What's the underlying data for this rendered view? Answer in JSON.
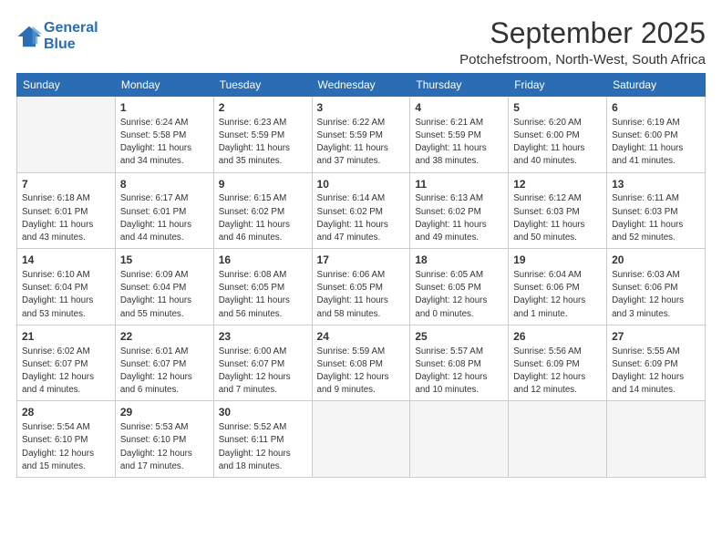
{
  "logo": {
    "line1": "General",
    "line2": "Blue"
  },
  "title": "September 2025",
  "subtitle": "Potchefstroom, North-West, South Africa",
  "days_of_week": [
    "Sunday",
    "Monday",
    "Tuesday",
    "Wednesday",
    "Thursday",
    "Friday",
    "Saturday"
  ],
  "weeks": [
    [
      {
        "day": "",
        "info": ""
      },
      {
        "day": "1",
        "info": "Sunrise: 6:24 AM\nSunset: 5:58 PM\nDaylight: 11 hours\nand 34 minutes."
      },
      {
        "day": "2",
        "info": "Sunrise: 6:23 AM\nSunset: 5:59 PM\nDaylight: 11 hours\nand 35 minutes."
      },
      {
        "day": "3",
        "info": "Sunrise: 6:22 AM\nSunset: 5:59 PM\nDaylight: 11 hours\nand 37 minutes."
      },
      {
        "day": "4",
        "info": "Sunrise: 6:21 AM\nSunset: 5:59 PM\nDaylight: 11 hours\nand 38 minutes."
      },
      {
        "day": "5",
        "info": "Sunrise: 6:20 AM\nSunset: 6:00 PM\nDaylight: 11 hours\nand 40 minutes."
      },
      {
        "day": "6",
        "info": "Sunrise: 6:19 AM\nSunset: 6:00 PM\nDaylight: 11 hours\nand 41 minutes."
      }
    ],
    [
      {
        "day": "7",
        "info": "Sunrise: 6:18 AM\nSunset: 6:01 PM\nDaylight: 11 hours\nand 43 minutes."
      },
      {
        "day": "8",
        "info": "Sunrise: 6:17 AM\nSunset: 6:01 PM\nDaylight: 11 hours\nand 44 minutes."
      },
      {
        "day": "9",
        "info": "Sunrise: 6:15 AM\nSunset: 6:02 PM\nDaylight: 11 hours\nand 46 minutes."
      },
      {
        "day": "10",
        "info": "Sunrise: 6:14 AM\nSunset: 6:02 PM\nDaylight: 11 hours\nand 47 minutes."
      },
      {
        "day": "11",
        "info": "Sunrise: 6:13 AM\nSunset: 6:02 PM\nDaylight: 11 hours\nand 49 minutes."
      },
      {
        "day": "12",
        "info": "Sunrise: 6:12 AM\nSunset: 6:03 PM\nDaylight: 11 hours\nand 50 minutes."
      },
      {
        "day": "13",
        "info": "Sunrise: 6:11 AM\nSunset: 6:03 PM\nDaylight: 11 hours\nand 52 minutes."
      }
    ],
    [
      {
        "day": "14",
        "info": "Sunrise: 6:10 AM\nSunset: 6:04 PM\nDaylight: 11 hours\nand 53 minutes."
      },
      {
        "day": "15",
        "info": "Sunrise: 6:09 AM\nSunset: 6:04 PM\nDaylight: 11 hours\nand 55 minutes."
      },
      {
        "day": "16",
        "info": "Sunrise: 6:08 AM\nSunset: 6:05 PM\nDaylight: 11 hours\nand 56 minutes."
      },
      {
        "day": "17",
        "info": "Sunrise: 6:06 AM\nSunset: 6:05 PM\nDaylight: 11 hours\nand 58 minutes."
      },
      {
        "day": "18",
        "info": "Sunrise: 6:05 AM\nSunset: 6:05 PM\nDaylight: 12 hours\nand 0 minutes."
      },
      {
        "day": "19",
        "info": "Sunrise: 6:04 AM\nSunset: 6:06 PM\nDaylight: 12 hours\nand 1 minute."
      },
      {
        "day": "20",
        "info": "Sunrise: 6:03 AM\nSunset: 6:06 PM\nDaylight: 12 hours\nand 3 minutes."
      }
    ],
    [
      {
        "day": "21",
        "info": "Sunrise: 6:02 AM\nSunset: 6:07 PM\nDaylight: 12 hours\nand 4 minutes."
      },
      {
        "day": "22",
        "info": "Sunrise: 6:01 AM\nSunset: 6:07 PM\nDaylight: 12 hours\nand 6 minutes."
      },
      {
        "day": "23",
        "info": "Sunrise: 6:00 AM\nSunset: 6:07 PM\nDaylight: 12 hours\nand 7 minutes."
      },
      {
        "day": "24",
        "info": "Sunrise: 5:59 AM\nSunset: 6:08 PM\nDaylight: 12 hours\nand 9 minutes."
      },
      {
        "day": "25",
        "info": "Sunrise: 5:57 AM\nSunset: 6:08 PM\nDaylight: 12 hours\nand 10 minutes."
      },
      {
        "day": "26",
        "info": "Sunrise: 5:56 AM\nSunset: 6:09 PM\nDaylight: 12 hours\nand 12 minutes."
      },
      {
        "day": "27",
        "info": "Sunrise: 5:55 AM\nSunset: 6:09 PM\nDaylight: 12 hours\nand 14 minutes."
      }
    ],
    [
      {
        "day": "28",
        "info": "Sunrise: 5:54 AM\nSunset: 6:10 PM\nDaylight: 12 hours\nand 15 minutes."
      },
      {
        "day": "29",
        "info": "Sunrise: 5:53 AM\nSunset: 6:10 PM\nDaylight: 12 hours\nand 17 minutes."
      },
      {
        "day": "30",
        "info": "Sunrise: 5:52 AM\nSunset: 6:11 PM\nDaylight: 12 hours\nand 18 minutes."
      },
      {
        "day": "",
        "info": ""
      },
      {
        "day": "",
        "info": ""
      },
      {
        "day": "",
        "info": ""
      },
      {
        "day": "",
        "info": ""
      }
    ]
  ]
}
